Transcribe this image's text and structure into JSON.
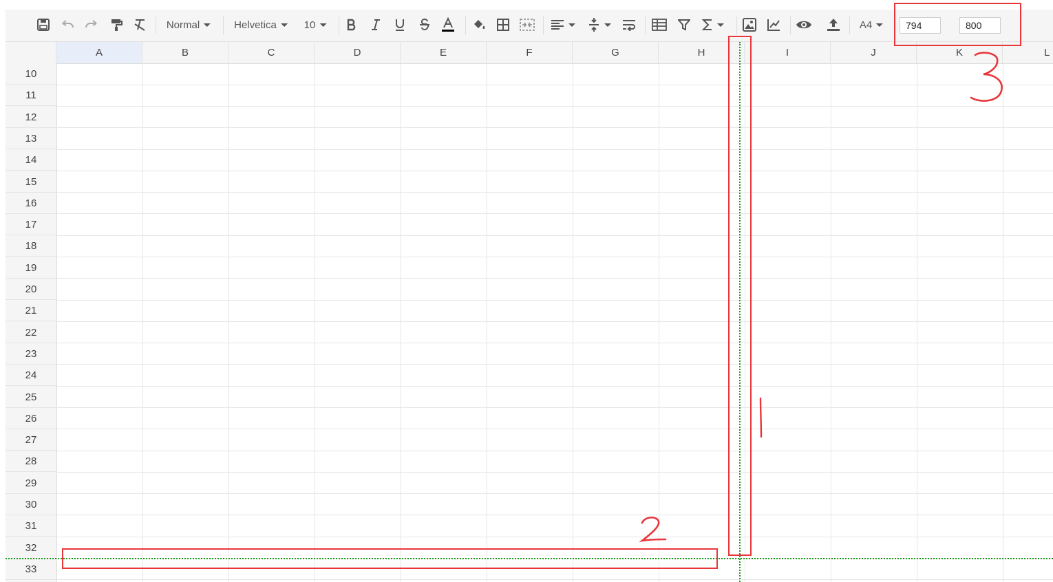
{
  "toolbar": {
    "icons": [
      "save-icon",
      "undo-icon",
      "redo-icon",
      "paint-format-icon",
      "clear-format-icon",
      "bold-icon",
      "italic-icon",
      "underline-icon",
      "strikethrough-icon",
      "text-color-icon",
      "fill-color-icon",
      "borders-icon",
      "merge-cells-icon",
      "align-icon",
      "valign-icon",
      "wrap-text-icon",
      "freeze-icon",
      "filter-icon",
      "sum-icon",
      "image-icon",
      "chart-icon",
      "preview-icon",
      "export-icon"
    ],
    "format_style": "Normal",
    "font_family": "Helvetica",
    "font_size": "10",
    "paper_size": "A4",
    "width_value": "794",
    "height_value": "800",
    "colors": {
      "text_color_underline": "#000000"
    }
  },
  "sheet": {
    "columns": [
      "A",
      "B",
      "C",
      "D",
      "E",
      "F",
      "G",
      "H",
      "I",
      "J",
      "K",
      "L"
    ],
    "selected_column": "A",
    "rows": [
      "10",
      "11",
      "12",
      "13",
      "14",
      "15",
      "16",
      "17",
      "18",
      "19",
      "20",
      "21",
      "22",
      "23",
      "24",
      "25",
      "26",
      "27",
      "28",
      "29",
      "30",
      "31",
      "32",
      "33"
    ]
  },
  "annotations": {
    "labels": [
      "1",
      "2",
      "3"
    ],
    "box_color": "#e8363b",
    "guide_color": "#1a9a1a"
  }
}
